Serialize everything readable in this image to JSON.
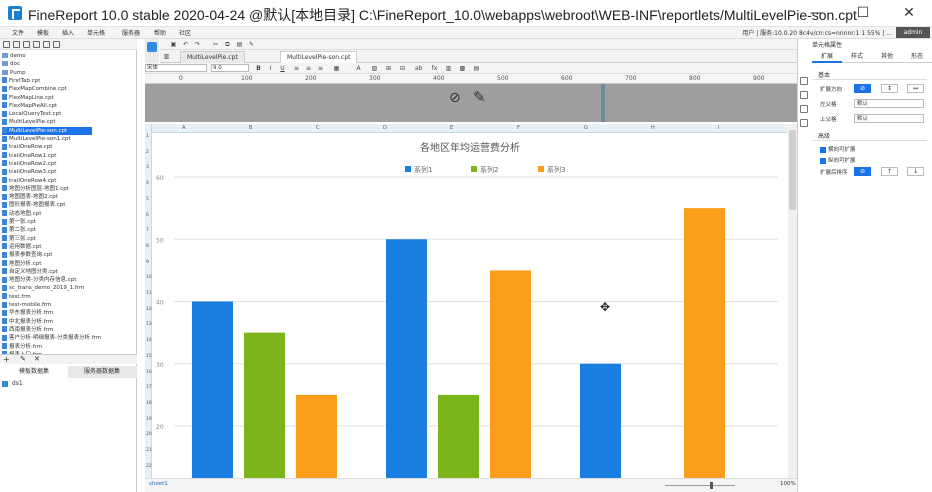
{
  "window": {
    "title": "FineReport 10.0 stable 2020-04-24 @默认[本地目录]    C:\\FineReport_10.0\\webapps\\webroot\\WEB-INF\\reportlets/MultiLevelPie-son.cpt",
    "minimize": "—",
    "maximize": "☐",
    "close": "✕"
  },
  "menu": {
    "items": [
      "文件",
      "模板",
      "插入",
      "单元格",
      "服务器",
      "帮助",
      "社区"
    ],
    "status": "用户 | 服务:10.0.20  8c4v/cn:cs=nnnnr:1  1 55%  | ...",
    "user": "admin"
  },
  "left_panel": {
    "tree": [
      {
        "label": "demo",
        "type": "folder"
      },
      {
        "label": "doc",
        "type": "folder"
      },
      {
        "label": "Pump",
        "type": "folder"
      },
      {
        "label": "FirstTab.cpt",
        "type": "file"
      },
      {
        "label": "FlexMapCombine.cpt",
        "type": "file"
      },
      {
        "label": "FlexMapLine.cpt",
        "type": "file"
      },
      {
        "label": "FlexMapPieAll.cpt",
        "type": "file"
      },
      {
        "label": "LocalQueryTest.cpt",
        "type": "file"
      },
      {
        "label": "MultiLevelPie.cpt",
        "type": "file"
      },
      {
        "label": "MultiLevelPie-son.cpt",
        "type": "file",
        "selected": true
      },
      {
        "label": "MultiLevelPie-son1.cpt",
        "type": "file"
      },
      {
        "label": "trailOneRow.cpt",
        "type": "file"
      },
      {
        "label": "trailOneRow1.cpt",
        "type": "file"
      },
      {
        "label": "trailOneRow2.cpt",
        "type": "file"
      },
      {
        "label": "trailOneRow3.cpt",
        "type": "file"
      },
      {
        "label": "trailOneRow4.cpt",
        "type": "file"
      },
      {
        "label": "地图分析图层-地图1.cpt",
        "type": "file"
      },
      {
        "label": "地图图表-地图2.cpt",
        "type": "file"
      },
      {
        "label": "图形报表-地图报表.cpt",
        "type": "file"
      },
      {
        "label": "动态地图.cpt",
        "type": "file"
      },
      {
        "label": "第一张.cpt",
        "type": "file"
      },
      {
        "label": "第二张.cpt",
        "type": "file"
      },
      {
        "label": "第三张.cpt",
        "type": "file"
      },
      {
        "label": "运用数据.cpt",
        "type": "file"
      },
      {
        "label": "报表参数查询.cpt",
        "type": "file"
      },
      {
        "label": "地图分析.cpt",
        "type": "file"
      },
      {
        "label": "自定义地图分类.cpt",
        "type": "file"
      },
      {
        "label": "地图分类-分类内存信息.cpt",
        "type": "file"
      },
      {
        "label": "sc_trans_demo_2019_1.frm",
        "type": "file"
      },
      {
        "label": "test.frm",
        "type": "file"
      },
      {
        "label": "test-mobile.frm",
        "type": "file"
      },
      {
        "label": "华东报表分析.frm",
        "type": "file"
      },
      {
        "label": "中北报表分析.frm",
        "type": "file"
      },
      {
        "label": "西南报表分析.frm",
        "type": "file"
      },
      {
        "label": "客户分析-明细报表-分类报表分析.frm",
        "type": "file"
      },
      {
        "label": "报表分析.frm",
        "type": "file"
      },
      {
        "label": "报表入口.frm",
        "type": "file"
      }
    ],
    "tabs": [
      "模板数据集",
      "服务器数据集"
    ],
    "dataset": "ds1"
  },
  "editor": {
    "file_tabs": [
      "MultiLevelPie.cpt",
      "MultiLevelPie-son.cpt"
    ],
    "font_name": "宋体",
    "font_size": "9.0",
    "ruler_marks": [
      "0",
      "100",
      "200",
      "300",
      "400",
      "500",
      "600",
      "700",
      "800",
      "900"
    ],
    "columns": [
      "A",
      "B",
      "C",
      "D",
      "E",
      "F",
      "G",
      "H",
      "I"
    ],
    "rows": [
      "1",
      "2",
      "3",
      "4",
      "5",
      "6",
      "7",
      "8",
      "9",
      "10",
      "11",
      "12",
      "13",
      "14",
      "15",
      "16",
      "17",
      "18",
      "19",
      "20",
      "21",
      "22"
    ],
    "sheet_tab": "sheet1",
    "zoom": "100%"
  },
  "right_panel": {
    "title": "单元格属性",
    "tabs": [
      "扩展",
      "样式",
      "其他",
      "形态"
    ],
    "section_basic": "基本",
    "expand_direction_label": "扩展方向",
    "left_parent_label": "左父格",
    "left_parent_value": "默认",
    "top_parent_label": "上父格",
    "top_parent_value": "默认",
    "section_advanced": "高级",
    "check_horizontal": "横向可扩展",
    "check_vertical": "纵向可扩展",
    "sort_label": "扩展后排序"
  },
  "chart_data": {
    "type": "bar",
    "title": "各地区年均运营费分析",
    "categories": [
      "",
      "",
      ""
    ],
    "series": [
      {
        "name": "系列1",
        "color": "#1a7ee0",
        "values": [
          40,
          50,
          30
        ]
      },
      {
        "name": "系列2",
        "color": "#7cb519",
        "values": [
          35,
          25,
          11
        ]
      },
      {
        "name": "系列3",
        "color": "#fb9f1a",
        "values": [
          25,
          45,
          55
        ]
      }
    ],
    "yticks": [
      60,
      50,
      40,
      30,
      20
    ],
    "ylim": [
      10,
      62
    ],
    "grid": true,
    "legend": "top-center"
  }
}
